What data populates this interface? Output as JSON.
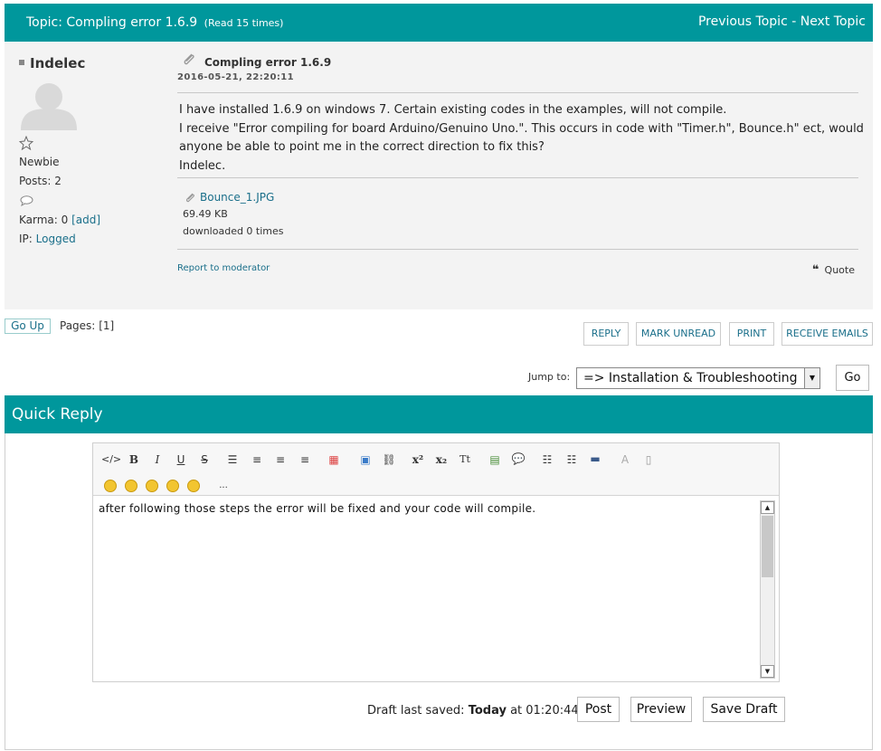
{
  "topic": {
    "title_prefix": "Topic: Compling error 1.6.9",
    "read_count": "(Read 15 times)",
    "previous": "Previous Topic",
    "separator": " - ",
    "next": "Next Topic"
  },
  "poster": {
    "name": "Indelec",
    "rank": "Newbie",
    "posts": "Posts: 2",
    "karma_label": "Karma: 0",
    "karma_add": "[add]",
    "ip_label": "IP:",
    "ip_value": "Logged"
  },
  "post": {
    "title": "Compling error 1.6.9",
    "date": "2016-05-21, 22:20:11",
    "body_lines": [
      "I have installed 1.6.9 on windows 7. Certain existing codes in the examples, will not compile.",
      "I receive \"Error compiling for board Arduino/Genuino Uno.\". This occurs  in code with \"Timer.h\", Bounce.h\" ect, would",
      "anyone be able to point me in the correct direction to fix this?",
      "Indelec."
    ],
    "attachment": {
      "name": "Bounce_1.JPG",
      "size": "69.49 KB",
      "downloads": "downloaded 0 times"
    },
    "report": "Report to moderator",
    "quote": "Quote"
  },
  "pagination": {
    "go_up": "Go Up",
    "pages_label": "Pages:",
    "pages_value": "[1]"
  },
  "actions": {
    "reply": "REPLY",
    "mark_unread": "MARK UNREAD",
    "print": "PRINT",
    "receive_emails": "RECEIVE EMAILS"
  },
  "jump": {
    "label": "Jump to:",
    "selected": "=> Installation & Troubleshooting",
    "go": "Go"
  },
  "quick_reply": {
    "title": "Quick Reply",
    "text": "after following those steps the error will be fixed and your code will compile.",
    "more_smileys": "...",
    "draft_label": "Draft last saved:",
    "draft_day": "Today",
    "draft_at": "at 01:20:44",
    "post": "Post",
    "preview": "Preview",
    "save_draft": "Save Draft"
  },
  "toolbar_icons": [
    "code-icon",
    "bold-icon",
    "italic-icon",
    "underline-icon",
    "strikethrough-icon",
    "align-left-icon",
    "align-left-2-icon",
    "align-center-icon",
    "align-right-icon",
    "color-icon",
    "image-icon",
    "link-icon",
    "superscript-icon",
    "subscript-icon",
    "teletype-icon",
    "table-icon",
    "quote-icon",
    "bullet-list-icon",
    "numbered-list-icon",
    "horizontal-rule-icon",
    "remove-format-icon",
    "source-icon"
  ],
  "colors": {
    "header": "#00979c",
    "link": "#1a6f8a",
    "post_bg": "#f3f3f3"
  }
}
